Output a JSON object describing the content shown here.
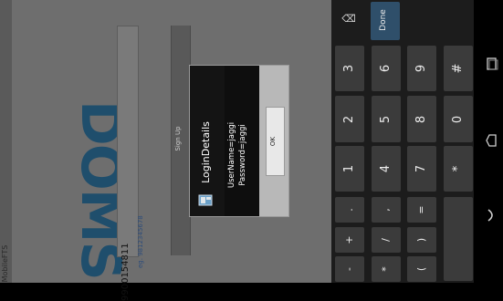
{
  "app": {
    "name": "MobileFTS",
    "logo": "DOMS",
    "input_value": "9900154811",
    "hint": "eg. 9812345678",
    "signup_label": "Sign Up"
  },
  "dialog": {
    "title": "LoginDetails",
    "message_line1": "UserName=jaggi",
    "message_line2": "Password=jaggi",
    "ok_label": "OK"
  },
  "keyboard": {
    "done_label": "Done",
    "backspace_icon": "backspace-icon",
    "rows": [
      [
        "3",
        "6",
        "9",
        "#"
      ],
      [
        "2",
        "5",
        "8",
        "0"
      ],
      [
        "1",
        "4",
        "7",
        "*"
      ],
      [
        ".",
        ",",
        "="
      ],
      [
        "+",
        "/",
        ")"
      ],
      [
        "-",
        "*",
        "("
      ]
    ]
  },
  "navbar": {
    "icons": [
      "recent-apps-icon",
      "home-icon",
      "back-icon"
    ]
  },
  "colors": {
    "accent": "#2f4f6a",
    "logo": "#1f4e6c",
    "keyboard_bg": "#1c1c1c",
    "key_bg": "#3b3b3b"
  }
}
